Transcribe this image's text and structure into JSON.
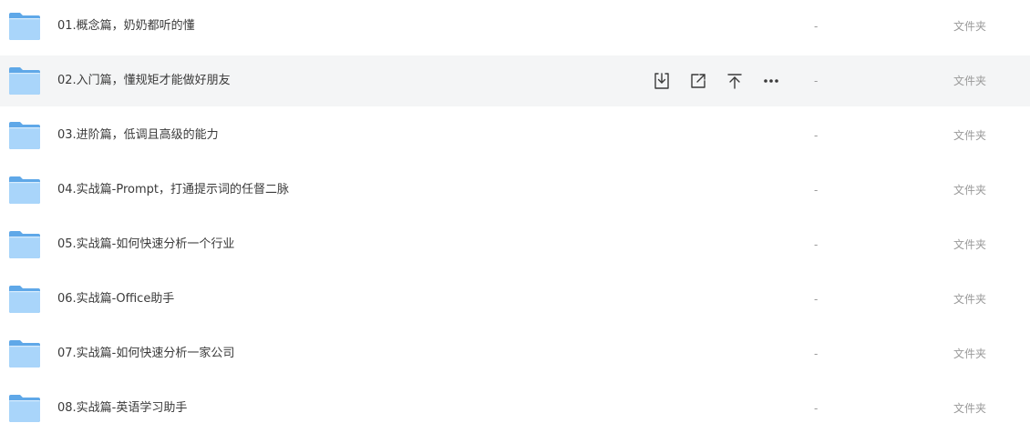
{
  "files": [
    {
      "name": "01.概念篇，奶奶都听的懂",
      "size": "-",
      "type": "文件夹",
      "hovered": false
    },
    {
      "name": "02.入门篇，懂规矩才能做好朋友",
      "size": "-",
      "type": "文件夹",
      "hovered": true
    },
    {
      "name": "03.进阶篇，低调且高级的能力",
      "size": "-",
      "type": "文件夹",
      "hovered": false
    },
    {
      "name": "04.实战篇-Prompt，打通提示词的任督二脉",
      "size": "-",
      "type": "文件夹",
      "hovered": false
    },
    {
      "name": "05.实战篇-如何快速分析一个行业",
      "size": "-",
      "type": "文件夹",
      "hovered": false
    },
    {
      "name": "06.实战篇-Office助手",
      "size": "-",
      "type": "文件夹",
      "hovered": false
    },
    {
      "name": "07.实战篇-如何快速分析一家公司",
      "size": "-",
      "type": "文件夹",
      "hovered": false
    },
    {
      "name": "08.实战篇-英语学习助手",
      "size": "-",
      "type": "文件夹",
      "hovered": false
    }
  ],
  "row_actions": [
    {
      "icon": "download-icon"
    },
    {
      "icon": "share-icon"
    },
    {
      "icon": "pin-top-icon"
    },
    {
      "icon": "more-icon"
    }
  ],
  "colors": {
    "folder_back": "#5fa8e8",
    "folder_front": "#a9d5fa",
    "hover_bg": "#f4f5f6",
    "icon_stroke": "#3a3a3a"
  }
}
